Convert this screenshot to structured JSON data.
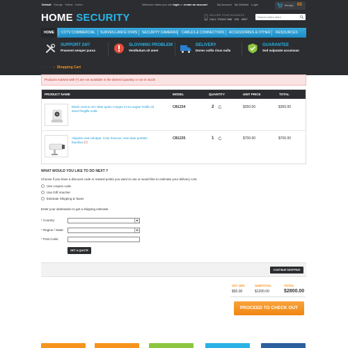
{
  "topbar": {
    "themes": [
      "Default",
      "Orange",
      "Yellow",
      "Green"
    ],
    "welcome_prefix": "Welcome visitor you can",
    "login": "login",
    "or": "or",
    "create_account": "create an account",
    "account_links": [
      "My Account",
      "My Wishlist",
      "Login"
    ],
    "cart_label": "Item(s)",
    "cart_count": "03"
  },
  "brand": {
    "logo_part1": "HOME",
    "logo_part2": "SECURITY",
    "secure_label": "SECURE YOUR BUSINESS",
    "phone": "CALL TODAY 888 · 234 · 4567",
    "search_placeholder": "Search entire store"
  },
  "nav": {
    "items": [
      "Home",
      "CCTV Commercial",
      "Surveillance DVRs",
      "Security Cameras",
      "Cables & Connectors",
      "Accessories & Other",
      "Resources"
    ]
  },
  "features": [
    {
      "title": "Support 24/7",
      "subtitle": "Praesent semper purus",
      "icon": "wrench-icon"
    },
    {
      "title": "Slovhing problem",
      "subtitle": "Vestibulum sit amet",
      "icon": "alert-icon"
    },
    {
      "title": "Delivery",
      "subtitle": "Donec sollis risus nulla",
      "icon": "truck-icon"
    },
    {
      "title": "Guarantee",
      "subtitle": "Sed vulputate accumsan",
      "icon": "shield-icon"
    }
  ],
  "breadcrumb": {
    "home": "Home",
    "separator": "›",
    "current": "Shopping Cart"
  },
  "alert": "Products marked with (*) are not available in the desired quantity or not in stock!",
  "table": {
    "headers": {
      "product": "Product Name",
      "model": "Model",
      "quantity": "Quantity",
      "unit": "Unit Price",
      "total": "Total"
    },
    "rows": [
      {
        "name": "Etiam cursus orci vitae quam congue mi ex augue mollis sit amet fringilla nulla",
        "marked": false,
        "model": "CB1234",
        "qty": "2",
        "unit": "$350.00",
        "total": "$350.00"
      },
      {
        "name": "Aliquam erat volutpat. Cras rhoncus, erat vitae porttitor faucibus",
        "marked": true,
        "model": "CB1235",
        "qty": "1",
        "unit": "$700.00",
        "total": "$700.00"
      }
    ]
  },
  "next": {
    "title": "What would you like to do next ?",
    "description": "Choose if you have a discount code or reward points you want to use or would like to estimate your delivery cost.",
    "options": [
      "Use coupon code",
      "Use Gift Voucher",
      "Estimate Shipping & Taxes"
    ],
    "destination": "Enter your destination to get a shipping estimate."
  },
  "form": {
    "country_label": "Country:",
    "region_label": "Region / State:",
    "postcode_label": "Post Code:",
    "quote_button": "Get a Quote"
  },
  "continue_button": "Continue Shopping",
  "totals": {
    "vat_label": "VAT 18%",
    "vat_value": "$50.00",
    "subtotal_label": "Subtotal",
    "subtotal_value": "$1200.00",
    "total_label": "Total",
    "total_value": "$2800.00"
  },
  "checkout_button": "Proceed to check out",
  "footer_tabs": [
    {
      "color": "#f7941d"
    },
    {
      "color": "#f7941d"
    },
    {
      "color": "#8cc63f"
    },
    {
      "color": "#2bb3e6"
    },
    {
      "color": "#2b5f9e"
    }
  ],
  "colors": {
    "accent": "#2bb3e6",
    "orange": "#f7941d",
    "dark": "#2b2d30"
  }
}
